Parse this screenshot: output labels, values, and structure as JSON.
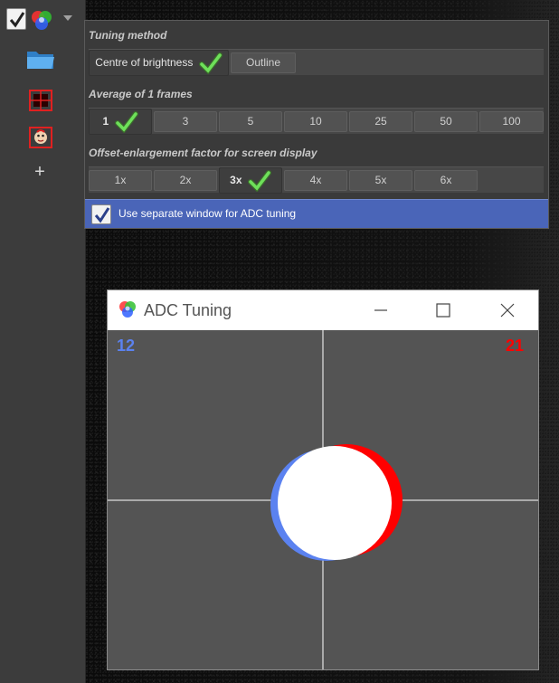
{
  "toolbar": {
    "icons": [
      "check-icon",
      "rgb-circles-icon",
      "dropdown-arrow-icon",
      "folder-icon",
      "crosshair-frame-icon",
      "face-frame-icon",
      "plus-icon"
    ],
    "plus_label": "+"
  },
  "panel": {
    "tuning_method": {
      "title": "Tuning method",
      "options": [
        "Centre of brightness",
        "Outline"
      ],
      "selected": "Centre of brightness"
    },
    "average": {
      "title": "Average of 1 frames",
      "options": [
        "1",
        "3",
        "5",
        "10",
        "25",
        "50",
        "100"
      ],
      "selected": "1"
    },
    "offset": {
      "title": "Offset-enlargement factor for screen display",
      "options": [
        "1x",
        "2x",
        "3x",
        "4x",
        "5x",
        "6x"
      ],
      "selected": "3x"
    },
    "separate_window": {
      "label": "Use separate window for ADC tuning",
      "checked": true
    }
  },
  "adc_window": {
    "title": "ADC Tuning",
    "left_value": "12",
    "right_value": "21",
    "colors": {
      "blue": "#5b82f0",
      "red": "#ff0000",
      "canvas": "#545454",
      "selection": "#4a65b8",
      "check_green": "#6ee05a"
    }
  }
}
